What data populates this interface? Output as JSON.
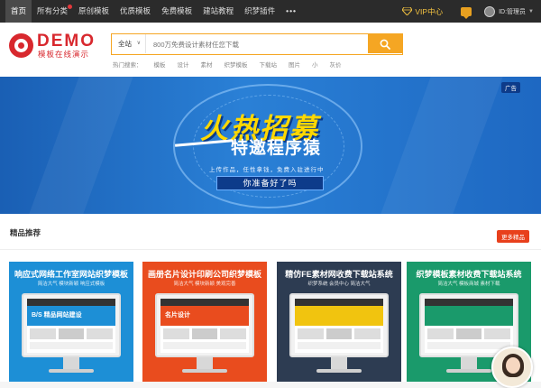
{
  "topnav": {
    "items": [
      {
        "label": "首页",
        "active": true
      },
      {
        "label": "所有分类",
        "active": false,
        "hot": true
      },
      {
        "label": "原创模板",
        "active": false
      },
      {
        "label": "优质模板",
        "active": false
      },
      {
        "label": "免费模板",
        "active": false
      },
      {
        "label": "建站教程",
        "active": false
      },
      {
        "label": "织梦插件",
        "active": false
      }
    ],
    "more_label": "•••",
    "vip_label": "VIP中心",
    "user_label": "ID:管理员",
    "vip_color": "#f0c040"
  },
  "logo": {
    "brand": "DEMO",
    "tagline": "模板在线演示",
    "color": "#d8282e"
  },
  "search": {
    "category": "全站",
    "placeholder": "800万免费设计素材任您下载",
    "accent": "#f5a623"
  },
  "hotwords": {
    "label": "热门搜索：",
    "items": [
      "模板",
      "设计",
      "素材",
      "织梦模板",
      "下载站",
      "图片",
      "小",
      "灰价"
    ]
  },
  "banner": {
    "headline": "火热招募",
    "subline": "特邀程序猿",
    "desc": "上传作品，任性拿钱，免费入驻进行中",
    "cta": "你准备好了吗",
    "ad_label": "广告"
  },
  "section": {
    "title": "精品推荐",
    "more_label": "更多精品"
  },
  "cards": [
    {
      "title": "响应式网络工作室网站织梦模板",
      "sub": "简洁大气 模块新颖 响应式模板",
      "color": "#1d8fd6",
      "screen": "blue",
      "overlay": "B/S 精品网站建设"
    },
    {
      "title": "画册名片设计印刷公司织梦模板",
      "sub": "简洁大气 模块新颖 美观完善",
      "color": "#e94c1e",
      "screen": "red",
      "overlay": "名片设计"
    },
    {
      "title": "精仿FE素材网收费下载站系统",
      "sub": "织梦系统 会员中心 简洁大气",
      "color": "#2d3c52",
      "screen": "yellow",
      "overlay": ""
    },
    {
      "title": "织梦模板素材收费下载站系统",
      "sub": "简洁大气 模板商城 素材下载",
      "color": "#1a9a6b",
      "screen": "green",
      "overlay": ""
    }
  ]
}
